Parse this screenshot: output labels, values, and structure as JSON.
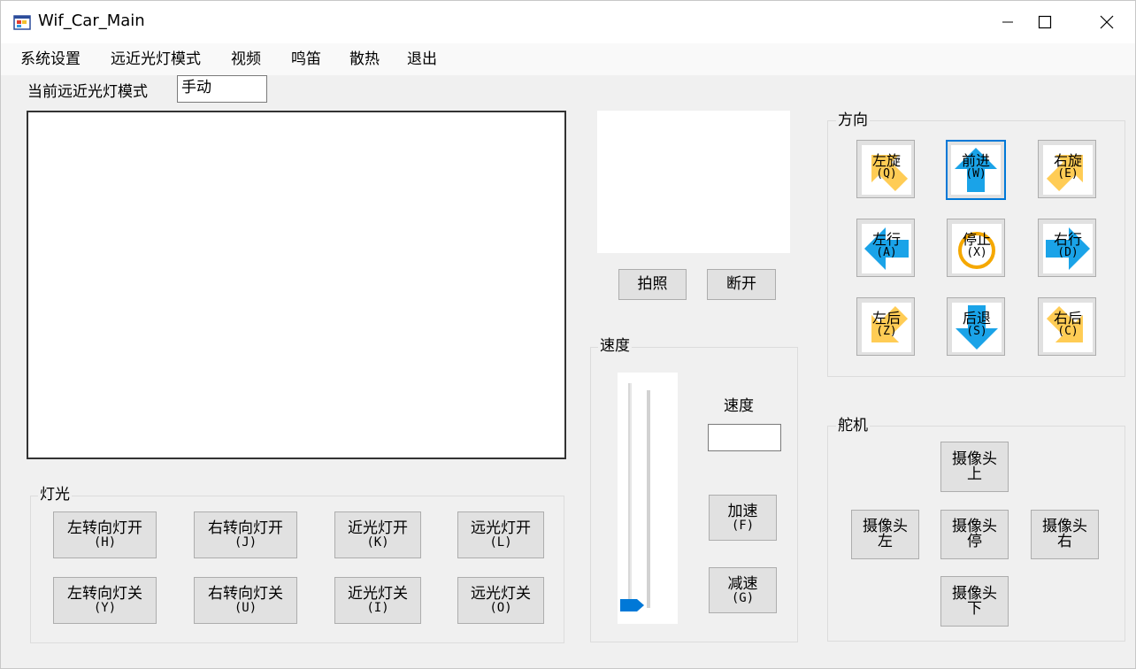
{
  "window": {
    "title": "Wif_Car_Main"
  },
  "menu": {
    "items": [
      "系统设置",
      "远近光灯模式",
      "视频",
      "鸣笛",
      "散热",
      "退出"
    ]
  },
  "beam_mode": {
    "label": "当前远近光灯模式",
    "value": "手动"
  },
  "photo": {
    "capture_label": "拍照",
    "disconnect_label": "断开"
  },
  "lights": {
    "title": "灯光",
    "buttons": [
      {
        "label": "左转向灯开",
        "key": "(H)"
      },
      {
        "label": "右转向灯开",
        "key": "(J)"
      },
      {
        "label": "近光灯开",
        "key": "(K)"
      },
      {
        "label": "远光灯开",
        "key": "(L)"
      },
      {
        "label": "左转向灯关",
        "key": "(Y)"
      },
      {
        "label": "右转向灯关",
        "key": "(U)"
      },
      {
        "label": "近光灯关",
        "key": "(I)"
      },
      {
        "label": "远光灯关",
        "key": "(O)"
      }
    ]
  },
  "speed": {
    "title": "速度",
    "label": "速度",
    "value": "",
    "slider_level": 0,
    "accel": {
      "label": "加速",
      "key": "(F)"
    },
    "decel": {
      "label": "减速",
      "key": "(G)"
    }
  },
  "direction": {
    "title": "方向",
    "buttons": [
      {
        "label": "左旋",
        "key": "(Q)",
        "icon": "rotate-left-icon",
        "color": "#ffcc55"
      },
      {
        "label": "前进",
        "key": "(W)",
        "icon": "arrow-up-icon",
        "color": "#1aa3e8"
      },
      {
        "label": "右旋",
        "key": "(E)",
        "icon": "rotate-right-icon",
        "color": "#ffcc55"
      },
      {
        "label": "左行",
        "key": "(A)",
        "icon": "arrow-left-icon",
        "color": "#1aa3e8"
      },
      {
        "label": "停止",
        "key": "(X)",
        "icon": "stop-icon",
        "color": "#f5a800"
      },
      {
        "label": "右行",
        "key": "(D)",
        "icon": "arrow-right-icon",
        "color": "#1aa3e8"
      },
      {
        "label": "左后",
        "key": "(Z)",
        "icon": "arrow-down-left-icon",
        "color": "#ffcc55"
      },
      {
        "label": "后退",
        "key": "(S)",
        "icon": "arrow-down-icon",
        "color": "#1aa3e8"
      },
      {
        "label": "右后",
        "key": "(C)",
        "icon": "arrow-down-right-icon",
        "color": "#ffcc55"
      }
    ]
  },
  "servo": {
    "title": "舵机",
    "up": {
      "line1": "摄像头",
      "line2": "上"
    },
    "left": {
      "line1": "摄像头",
      "line2": "左"
    },
    "stop": {
      "line1": "摄像头",
      "line2": "停"
    },
    "right": {
      "line1": "摄像头",
      "line2": "右"
    },
    "down": {
      "line1": "摄像头",
      "line2": "下"
    }
  }
}
